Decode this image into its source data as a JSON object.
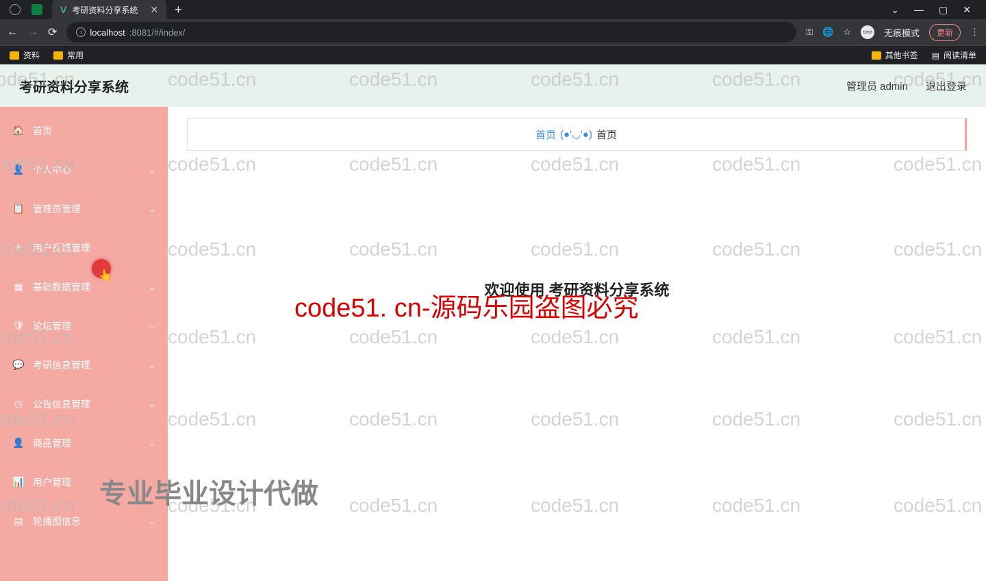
{
  "browser": {
    "tab_title": "考研资料分享系统",
    "new_tab": "+",
    "win": {
      "minimize": "—",
      "maximize": "▢",
      "close": "✕",
      "dropdown": "⌄"
    },
    "nav": {
      "back": "←",
      "forward": "→",
      "reload": "⟳"
    },
    "url_host": "localhost",
    "url_port_path": ":8081/#/index/",
    "key_icon": "⚿",
    "translate_icon": "🌐",
    "star_icon": "☆",
    "incognito_label": "无痕模式",
    "update_label": "更新",
    "menu_icon": "⋮"
  },
  "bookmarks": {
    "left": [
      {
        "label": "资料"
      },
      {
        "label": "常用"
      }
    ],
    "right": {
      "other": "其他书签",
      "reading": "阅读清单"
    }
  },
  "app": {
    "title": "考研资料分享系统",
    "user_label": "管理员 admin",
    "logout_label": "退出登录"
  },
  "sidebar": {
    "items": [
      {
        "icon": "🏠",
        "label": "首页",
        "expandable": false
      },
      {
        "icon": "👤",
        "label": "个人中心",
        "expandable": true
      },
      {
        "icon": "📋",
        "label": "管理员管理",
        "expandable": true
      },
      {
        "icon": "✈",
        "label": "用户反馈管理",
        "expandable": false
      },
      {
        "icon": "▦",
        "label": "基础数据管理",
        "expandable": true
      },
      {
        "icon": "🛡",
        "label": "论坛管理",
        "expandable": true
      },
      {
        "icon": "💬",
        "label": "考研信息管理",
        "expandable": true
      },
      {
        "icon": "◷",
        "label": "公告信息管理",
        "expandable": true
      },
      {
        "icon": "👤",
        "label": "商品管理",
        "expandable": true
      },
      {
        "icon": "📊",
        "label": "用户管理",
        "expandable": false
      },
      {
        "icon": "▤",
        "label": "轮播图信息",
        "expandable": true
      }
    ]
  },
  "breadcrumb": {
    "link": "首页",
    "face": "(●'◡'●)",
    "current": "首页"
  },
  "main": {
    "welcome": "欢迎使用 考研资料分享系统"
  },
  "watermark": {
    "repeat": "code51.cn",
    "red": "code51. cn-源码乐园盗图必究",
    "gray_big": "专业毕业设计代做"
  }
}
